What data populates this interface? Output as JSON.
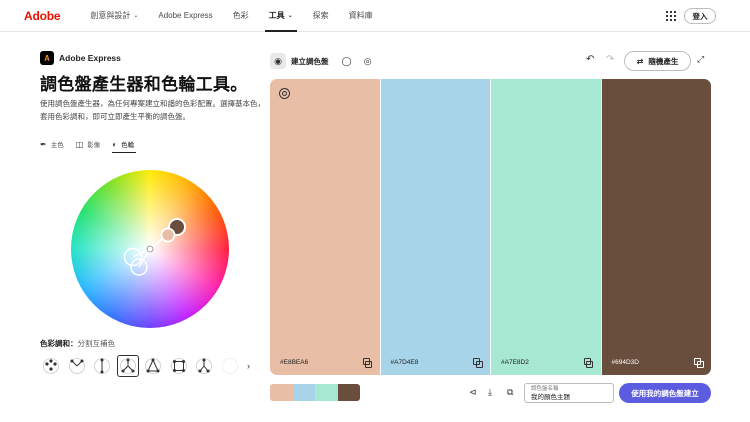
{
  "nav": {
    "logo": "Adobe",
    "links": [
      "創意與設計",
      "Adobe Express",
      "色彩",
      "工具",
      "探索",
      "資料庫"
    ],
    "signin": "登入"
  },
  "left": {
    "brand": "Adobe Express",
    "headline": "調色盤產生器和色輪工具。",
    "description": "使用調色盤產生器，為任何專案建立和諧的色彩配置。選擇基本色，套用色彩調和，即可立即產生平衡的調色盤。",
    "modes": [
      "主色",
      "影像",
      "色輪"
    ],
    "harmony_label": "色彩調和：",
    "harmony_value": "分割互補色"
  },
  "toolbar": {
    "create_label": "建立調色盤",
    "random_label": "隨機產生"
  },
  "palette": [
    {
      "hex": "#E8BEA6",
      "color": "#E8BEA6",
      "dark": false
    },
    {
      "hex": "#A7D4E8",
      "color": "#A7D4E8",
      "dark": false
    },
    {
      "hex": "#A7E8D2",
      "color": "#A7E8D2",
      "dark": false
    },
    {
      "hex": "#694D3D",
      "color": "#694D3D",
      "dark": true
    }
  ],
  "bottom": {
    "name_label": "調色盤名稱",
    "name_value": "我的顏色主題",
    "use_label": "使用我的調色盤建立"
  },
  "colors": {
    "accent": "#5C5CE0",
    "brand": "#EB1000"
  }
}
